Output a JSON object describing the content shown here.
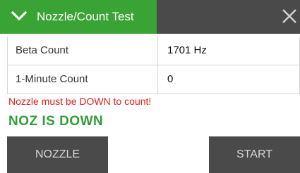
{
  "header": {
    "title": "Nozzle/Count Test",
    "tab_color": "#3aa335",
    "bar_color": "#4a4a4a"
  },
  "table": {
    "rows": [
      {
        "label": "Beta Count",
        "value": "1701 Hz"
      },
      {
        "label": "1-Minute Count",
        "value": "0"
      }
    ]
  },
  "messages": {
    "warning": "Nozzle must be DOWN to count!",
    "warning_color": "#e11d1d",
    "status": "NOZ IS DOWN",
    "status_color": "#2f9e3a"
  },
  "buttons": {
    "nozzle": "NOZZLE",
    "start": "START"
  },
  "icons": {
    "collapse": "chevron-down-icon",
    "close": "close-icon"
  }
}
